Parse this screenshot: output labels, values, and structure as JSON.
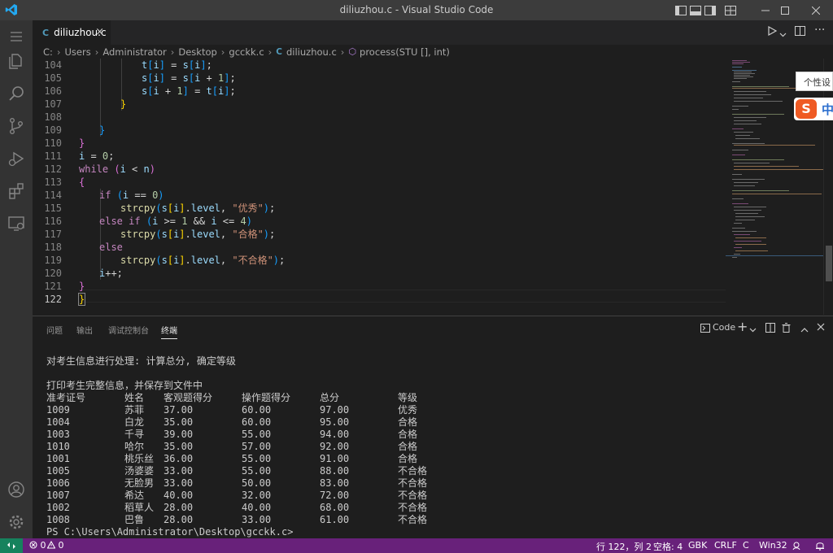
{
  "window": {
    "title": "diliuzhou.c - Visual Studio Code"
  },
  "activity_bar": {
    "items": [
      "explorer-icon",
      "search-icon",
      "source-control-icon",
      "run-debug-icon",
      "extensions-icon",
      "remote-explorer-icon"
    ],
    "bottom": [
      "account-icon",
      "manage-gear-icon"
    ]
  },
  "tab": {
    "icon": "C",
    "label": "diliuzhou.c",
    "close": "×"
  },
  "breadcrumb": {
    "parts": [
      "C:",
      "Users",
      "Administrator",
      "Desktop",
      "gcckk.c"
    ],
    "file_icon": "C",
    "file": "diliuzhou.c",
    "symbol": "process(STU [], int)"
  },
  "editor": {
    "line_numbers": [
      "104",
      "105",
      "106",
      "107",
      "108",
      "109",
      "110",
      "111",
      "112",
      "113",
      "114",
      "115",
      "116",
      "117",
      "118",
      "119",
      "120",
      "121",
      "122"
    ],
    "active_line": "122"
  },
  "ime": {
    "tooltip": "个性设",
    "logo": "S",
    "mode": "中"
  },
  "panel": {
    "tabs": [
      "问题",
      "输出",
      "调试控制台",
      "终端"
    ],
    "active_tab": "终端",
    "terminal_name": "Code",
    "terminal": {
      "line1": "对考生信息进行处理: 计算总分, 确定等级",
      "line2": "打印考生完整信息，并保存到文件中",
      "headers": [
        "准考证号",
        "姓名",
        "客观题得分",
        "操作题得分",
        "总分",
        "等级"
      ],
      "rows": [
        [
          "1009",
          "苏菲",
          "37.00",
          "60.00",
          "97.00",
          "优秀"
        ],
        [
          "1004",
          "白龙",
          "35.00",
          "60.00",
          "95.00",
          "合格"
        ],
        [
          "1003",
          "千寻",
          "39.00",
          "55.00",
          "94.00",
          "合格"
        ],
        [
          "1010",
          "哈尔",
          "35.00",
          "57.00",
          "92.00",
          "合格"
        ],
        [
          "1001",
          "桃乐丝",
          "36.00",
          "55.00",
          "91.00",
          "合格"
        ],
        [
          "1005",
          "汤婆婆",
          "33.00",
          "55.00",
          "88.00",
          "不合格"
        ],
        [
          "1006",
          "无脸男",
          "33.00",
          "50.00",
          "83.00",
          "不合格"
        ],
        [
          "1007",
          "希达",
          "40.00",
          "32.00",
          "72.00",
          "不合格"
        ],
        [
          "1002",
          "稻草人",
          "28.00",
          "40.00",
          "68.00",
          "不合格"
        ],
        [
          "1008",
          "巴鲁",
          "28.00",
          "33.00",
          "61.00",
          "不合格"
        ]
      ],
      "prompt": "PS C:\\Users\\Administrator\\Desktop\\gcckk.c>"
    }
  },
  "status_bar": {
    "errors": "0",
    "warnings": "0",
    "position": "行 122，列 2",
    "spaces": "空格: 4",
    "encoding": "GBK",
    "eol": "CRLF",
    "language": "C",
    "platform": "Win32",
    "colors": {
      "bar": "#68217a",
      "remote": "#16825d"
    }
  }
}
